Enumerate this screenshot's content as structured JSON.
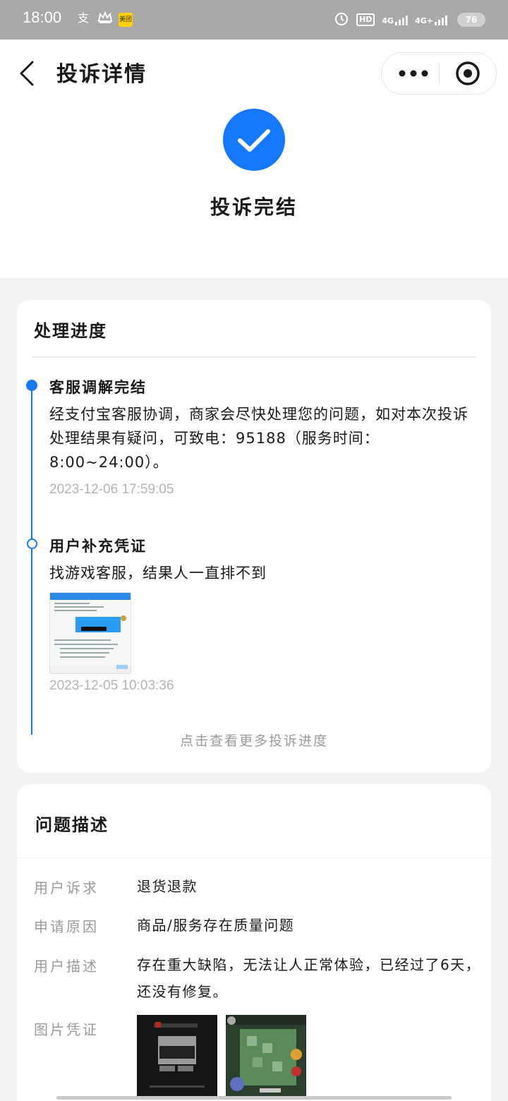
{
  "status_bar": {
    "time": "18:00",
    "icons": [
      "alipay-icon",
      "crown-icon",
      "meituan-icon"
    ],
    "meituan_label": "美团",
    "right_icons": [
      "alarm-icon",
      "hd-icon",
      "signal-4g-icon",
      "signal-4g-plus-icon"
    ],
    "hd_label": "HD",
    "network_1": "4G",
    "network_2": "4G+",
    "battery": "76"
  },
  "header": {
    "title": "投诉详情",
    "status_text": "投诉完结",
    "status_icon": "check-circle-icon",
    "accent_color": "#1677ff"
  },
  "progress": {
    "title": "处理进度",
    "steps": [
      {
        "title": "客服调解完结",
        "description": "经支付宝客服协调，商家会尽快处理您的问题，如对本次投诉处理结果有疑问，可致电：95188（服务时间：8:00~24:00）。",
        "time": "2023-12-06 17:59:05"
      },
      {
        "title": "用户补充凭证",
        "description": "找游戏客服，结果人一直排不到",
        "time": "2023-12-05 10:03:36"
      }
    ],
    "more_link": "点击查看更多投诉进度"
  },
  "problem": {
    "title": "问题描述",
    "rows": [
      {
        "label": "用户诉求",
        "value": "退货退款"
      },
      {
        "label": "申请原因",
        "value": "商品/服务存在质量问题"
      },
      {
        "label": "用户描述",
        "value": "存在重大缺陷，无法让人正常体验，已经过了6天，还没有修复。"
      }
    ],
    "image_label": "图片凭证"
  }
}
